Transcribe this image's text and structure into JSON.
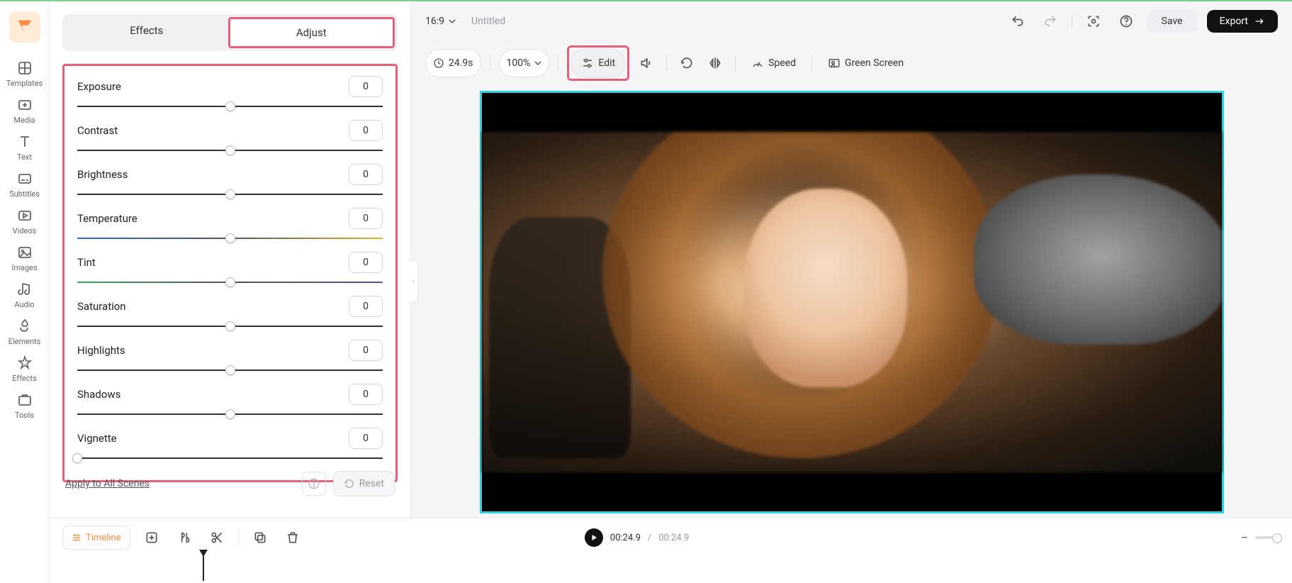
{
  "rail": {
    "items": [
      {
        "icon": "templates",
        "label": "Templates"
      },
      {
        "icon": "media",
        "label": "Media"
      },
      {
        "icon": "text",
        "label": "Text"
      },
      {
        "icon": "subtitles",
        "label": "Subtitles"
      },
      {
        "icon": "videos",
        "label": "Videos"
      },
      {
        "icon": "images",
        "label": "Images"
      },
      {
        "icon": "audio",
        "label": "Audio"
      },
      {
        "icon": "elements",
        "label": "Elements"
      },
      {
        "icon": "effects",
        "label": "Effects"
      },
      {
        "icon": "tools",
        "label": "Tools"
      }
    ]
  },
  "panel": {
    "tabs": {
      "effects": "Effects",
      "adjust": "Adjust",
      "active": "adjust"
    },
    "adjust": [
      {
        "key": "exposure",
        "label": "Exposure",
        "value": "0",
        "thumb": 50,
        "style": "normal"
      },
      {
        "key": "contrast",
        "label": "Contrast",
        "value": "0",
        "thumb": 50,
        "style": "normal"
      },
      {
        "key": "brightness",
        "label": "Brightness",
        "value": "0",
        "thumb": 50,
        "style": "normal"
      },
      {
        "key": "temperature",
        "label": "Temperature",
        "value": "0",
        "thumb": 50,
        "style": "temperature"
      },
      {
        "key": "tint",
        "label": "Tint",
        "value": "0",
        "thumb": 50,
        "style": "tint"
      },
      {
        "key": "saturation",
        "label": "Saturation",
        "value": "0",
        "thumb": 50,
        "style": "normal"
      },
      {
        "key": "highlights",
        "label": "Highlights",
        "value": "0",
        "thumb": 50,
        "style": "normal"
      },
      {
        "key": "shadows",
        "label": "Shadows",
        "value": "0",
        "thumb": 50,
        "style": "normal"
      },
      {
        "key": "vignette",
        "label": "Vignette",
        "value": "0",
        "thumb": 0,
        "style": "normal"
      }
    ],
    "apply_all": "Apply to All Scenes",
    "reset": "Reset"
  },
  "topbar": {
    "aspect": "16:9",
    "title": "Untitled",
    "save": "Save",
    "export": "Export"
  },
  "toolbar": {
    "duration": "24.9s",
    "zoom": "100%",
    "edit": "Edit",
    "speed": "Speed",
    "green": "Green Screen"
  },
  "timeline": {
    "label": "Timeline",
    "cur": "00:24.9",
    "sep": "/",
    "total": "00:24.9"
  }
}
